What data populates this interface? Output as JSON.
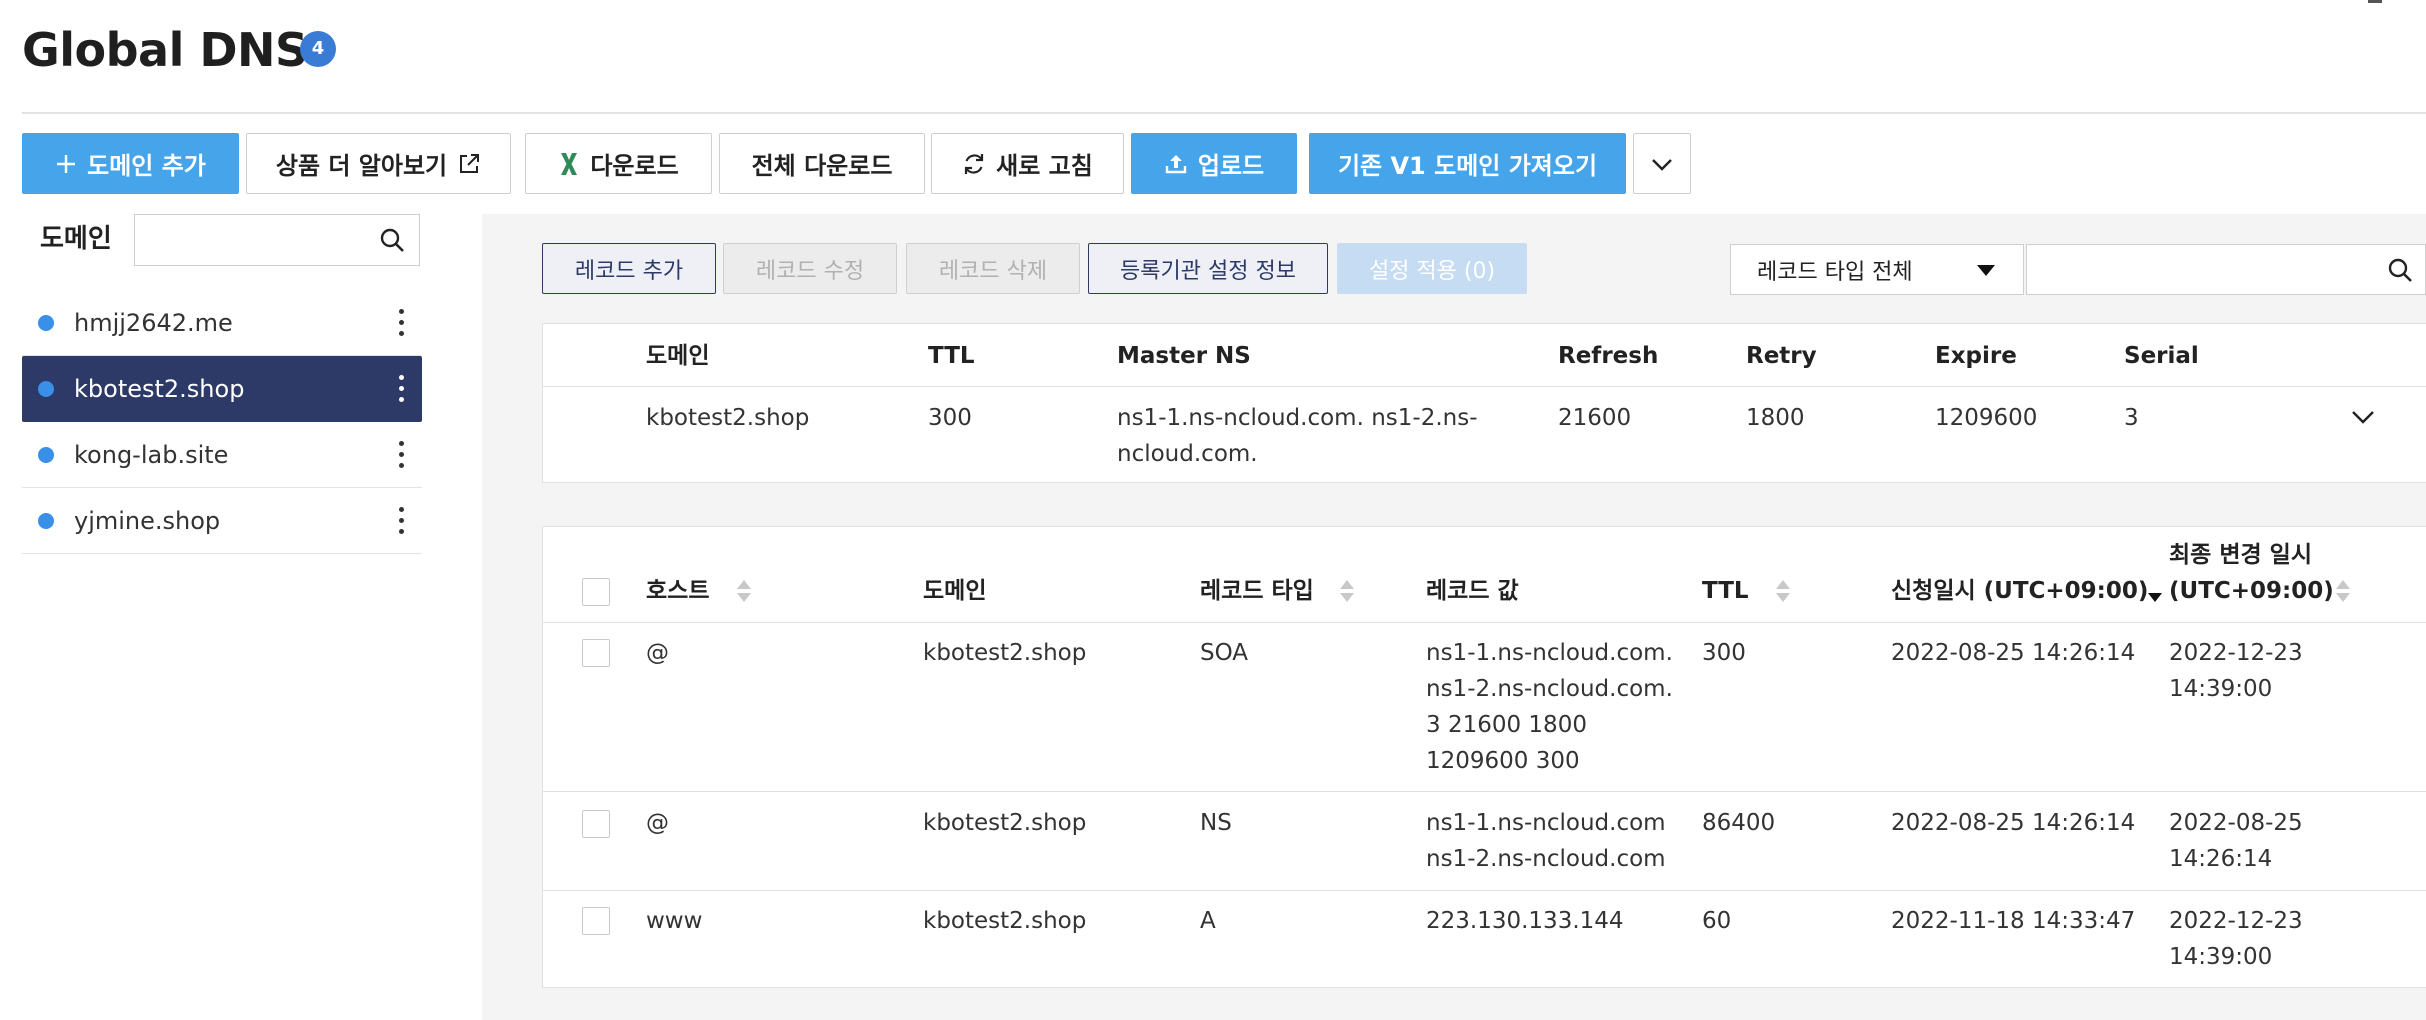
{
  "header": {
    "title": "Global DNS",
    "badge_count": "4"
  },
  "toolbar": {
    "add_domain": "도메인 추가",
    "learn_more": "상품 더 알아보기",
    "download": "다운로드",
    "download_all": "전체 다운로드",
    "refresh": "새로 고침",
    "upload": "업로드",
    "import_v1": "기존 V1 도메인 가져오기"
  },
  "sidebar": {
    "label": "도메인",
    "search_placeholder": "",
    "domains": [
      {
        "name": "hmjj2642.me"
      },
      {
        "name": "kbotest2.shop"
      },
      {
        "name": "kong-lab.site"
      },
      {
        "name": "yjmine.shop"
      }
    ],
    "selected_index": 1
  },
  "record_actions": {
    "add": "레코드 추가",
    "edit": "레코드 수정",
    "delete": "레코드 삭제",
    "registrar_info": "등록기관 설정 정보",
    "apply": "설정 적용 (0)"
  },
  "filter": {
    "record_type": "레코드 타입 전체",
    "search_placeholder": ""
  },
  "domain_info": {
    "headers": {
      "domain": "도메인",
      "ttl": "TTL",
      "master_ns": "Master NS",
      "refresh": "Refresh",
      "retry": "Retry",
      "expire": "Expire",
      "serial": "Serial"
    },
    "values": {
      "domain": "kbotest2.shop",
      "ttl": "300",
      "master_ns": "ns1-1.ns-ncloud.com. ns1-2.ns-\nncloud.com.",
      "refresh": "21600",
      "retry": "1800",
      "expire": "1209600",
      "serial": "3"
    }
  },
  "records": {
    "headers": {
      "host": "호스트",
      "domain": "도메인",
      "record_type": "레코드 타입",
      "record_value": "레코드 값",
      "ttl": "TTL",
      "created": "신청일시 (UTC+09:00)",
      "modified": "최종 변경 일시\n(UTC+09:00)"
    },
    "rows": [
      {
        "host": "@",
        "domain": "kbotest2.shop",
        "type": "SOA",
        "value": "ns1-1.ns-ncloud.com.\nns1-2.ns-ncloud.com.\n3 21600 1800\n1209600 300",
        "ttl": "300",
        "created": "2022-08-25 14:26:14",
        "modified": "2022-12-23\n14:39:00"
      },
      {
        "host": "@",
        "domain": "kbotest2.shop",
        "type": "NS",
        "value": "ns1-1.ns-ncloud.com\nns1-2.ns-ncloud.com",
        "ttl": "86400",
        "created": "2022-08-25 14:26:14",
        "modified": "2022-08-25\n14:26:14"
      },
      {
        "host": "www",
        "domain": "kbotest2.shop",
        "type": "A",
        "value": "223.130.133.144",
        "ttl": "60",
        "created": "2022-11-18 14:33:47",
        "modified": "2022-12-23\n14:39:00"
      }
    ]
  },
  "colors": {
    "primary": "#45a4ea",
    "selected_nav": "#2d3a68",
    "badge": "#3a7bd5",
    "excel_green": "#2e8b57"
  },
  "icons": {
    "add": "plus-icon",
    "external": "external-link-icon",
    "excel": "excel-icon",
    "refresh": "refresh-icon",
    "upload": "upload-icon",
    "more": "chevron-down-icon",
    "search": "search-icon",
    "row_menu": "kebab-icon"
  }
}
